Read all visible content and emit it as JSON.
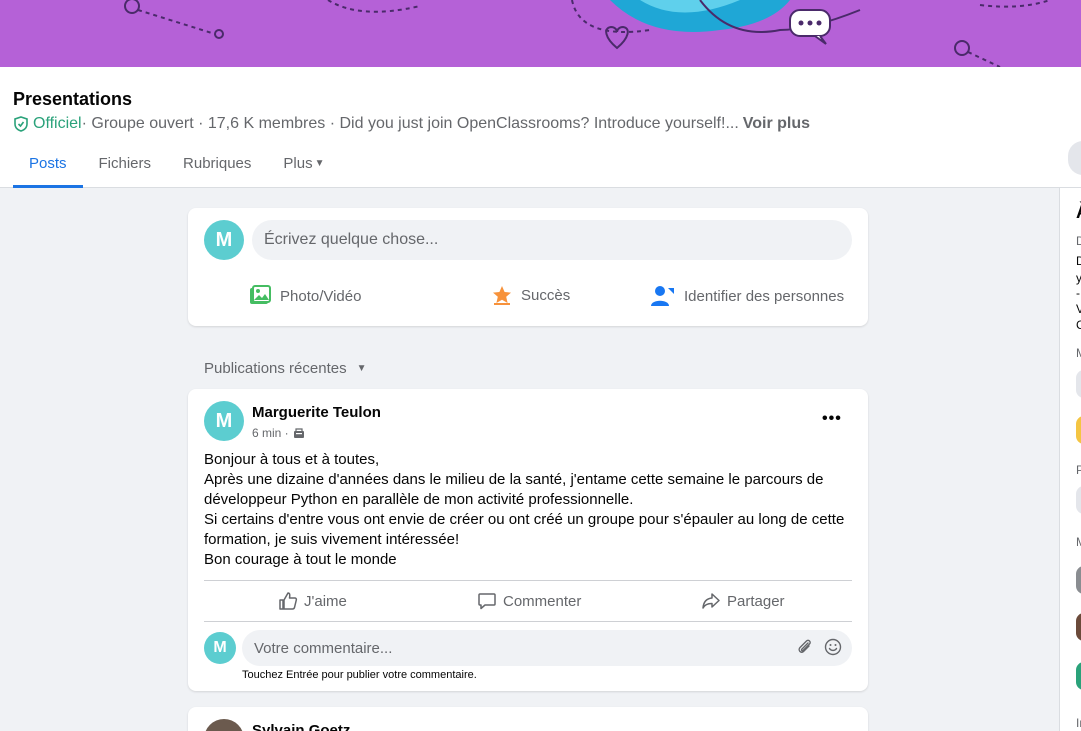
{
  "group": {
    "title": "Presentations",
    "official_label": "Officiel",
    "meta": " · Groupe ouvert · 17,6 K membres · Did you just join OpenClassrooms? Introduce yourself!...",
    "see_more": "Voir plus"
  },
  "tabs": [
    {
      "label": "Posts",
      "active": true
    },
    {
      "label": "Fichiers",
      "active": false
    },
    {
      "label": "Rubriques",
      "active": false
    },
    {
      "label": "Plus",
      "active": false
    }
  ],
  "composer": {
    "avatar_letter": "M",
    "placeholder": "Écrivez quelque chose...",
    "actions": {
      "photo": "Photo/Vidéo",
      "success": "Succès",
      "tag": "Identifier des personnes"
    }
  },
  "sort_label": "Publications récentes",
  "post": {
    "avatar_letter": "M",
    "author": "Marguerite Teulon",
    "time": "6 min ·",
    "body": [
      "Bonjour à tous et à toutes,",
      "Après une dizaine d'années dans le milieu de la santé, j'entame cette semaine le parcours de développeur Python en parallèle de mon activité professionnelle.",
      "Si certains d'entre vous ont envie de créer ou ont créé un groupe pour s'épauler au long de cette formation, je suis vivement intéressée!",
      "Bon courage à tout le monde"
    ],
    "actions": {
      "like": "J'aime",
      "comment": "Commenter",
      "share": "Partager"
    },
    "comment_avatar_letter": "M",
    "comment_placeholder": "Votre commentaire...",
    "comment_hint": "Touchez Entrée pour publier votre commentaire."
  },
  "next_post": {
    "author": "Sylvain Goetz"
  },
  "right_rail_letters": [
    "À",
    "D",
    "D",
    "y",
    "-",
    "V",
    "C",
    "M",
    "P",
    "M",
    "In"
  ],
  "colors": {
    "banner": "#b561d7",
    "accent": "#1b74e4",
    "official": "#2aa27a",
    "avatar": "#5ccdd0"
  }
}
